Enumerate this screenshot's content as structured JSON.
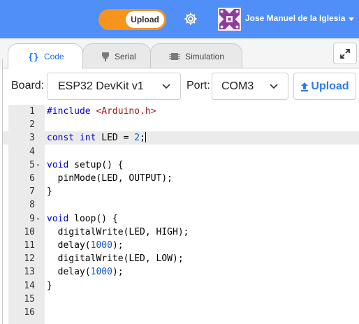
{
  "header": {
    "mode_label": "Upload",
    "username": "Jose Manuel de la Iglesia",
    "brand_color": "#4f8ff7",
    "toggle_color": "#f7941d"
  },
  "tabs": [
    {
      "label": "Code",
      "icon": "braces-icon",
      "active": true
    },
    {
      "label": "Serial",
      "icon": "plug-icon",
      "active": false
    },
    {
      "label": "Simulation",
      "icon": "chip-icon",
      "active": false
    }
  ],
  "toolbar": {
    "board_label": "Board:",
    "board_value": "ESP32 DevKit v1",
    "port_label": "Port:",
    "port_value": "COM3",
    "upload_label": "Upload",
    "accent_color": "#2b7de9"
  },
  "editor": {
    "active_line": 3,
    "lines": [
      {
        "n": "1",
        "text": "#include <Arduino.h>"
      },
      {
        "n": "2",
        "text": ""
      },
      {
        "n": "3",
        "text": "const int LED = 2;"
      },
      {
        "n": "4",
        "text": ""
      },
      {
        "n": "5",
        "text": "void setup() {"
      },
      {
        "n": "6",
        "text": "  pinMode(LED, OUTPUT);"
      },
      {
        "n": "7",
        "text": "}"
      },
      {
        "n": "8",
        "text": ""
      },
      {
        "n": "9",
        "text": "void loop() {"
      },
      {
        "n": "10",
        "text": "  digitalWrite(LED, HIGH);"
      },
      {
        "n": "11",
        "text": "  delay(1000);"
      },
      {
        "n": "12",
        "text": "  digitalWrite(LED, LOW);"
      },
      {
        "n": "13",
        "text": "  delay(1000);"
      },
      {
        "n": "14",
        "text": "}"
      },
      {
        "n": "15",
        "text": ""
      },
      {
        "n": "16",
        "text": ""
      }
    ]
  }
}
